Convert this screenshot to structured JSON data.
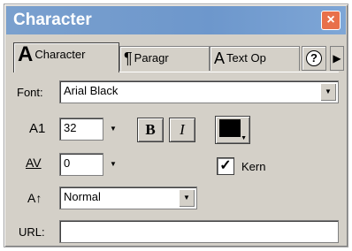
{
  "window": {
    "title": "Character",
    "close_glyph": "×"
  },
  "tabs": [
    {
      "label": "Character",
      "glyph": "A"
    },
    {
      "label": "Paragr",
      "glyph": "¶"
    },
    {
      "label": "Text Op",
      "glyph": "A"
    }
  ],
  "help": {
    "glyph": "?"
  },
  "tab_more": {
    "glyph": "▶"
  },
  "font": {
    "label": "Font:",
    "value": "Arial Black"
  },
  "size": {
    "label": "A1",
    "value": "32"
  },
  "tracking": {
    "label": "AV",
    "value": "0"
  },
  "baseline": {
    "label": "A↑",
    "value": "Normal"
  },
  "format": {
    "bold": "B",
    "italic": "I"
  },
  "text_color": {
    "value": "#000000"
  },
  "kern": {
    "checked": true,
    "label": "Kern",
    "check_glyph": "✓"
  },
  "url": {
    "label": "URL:",
    "value": ""
  },
  "dropdown_glyph": "▼"
}
